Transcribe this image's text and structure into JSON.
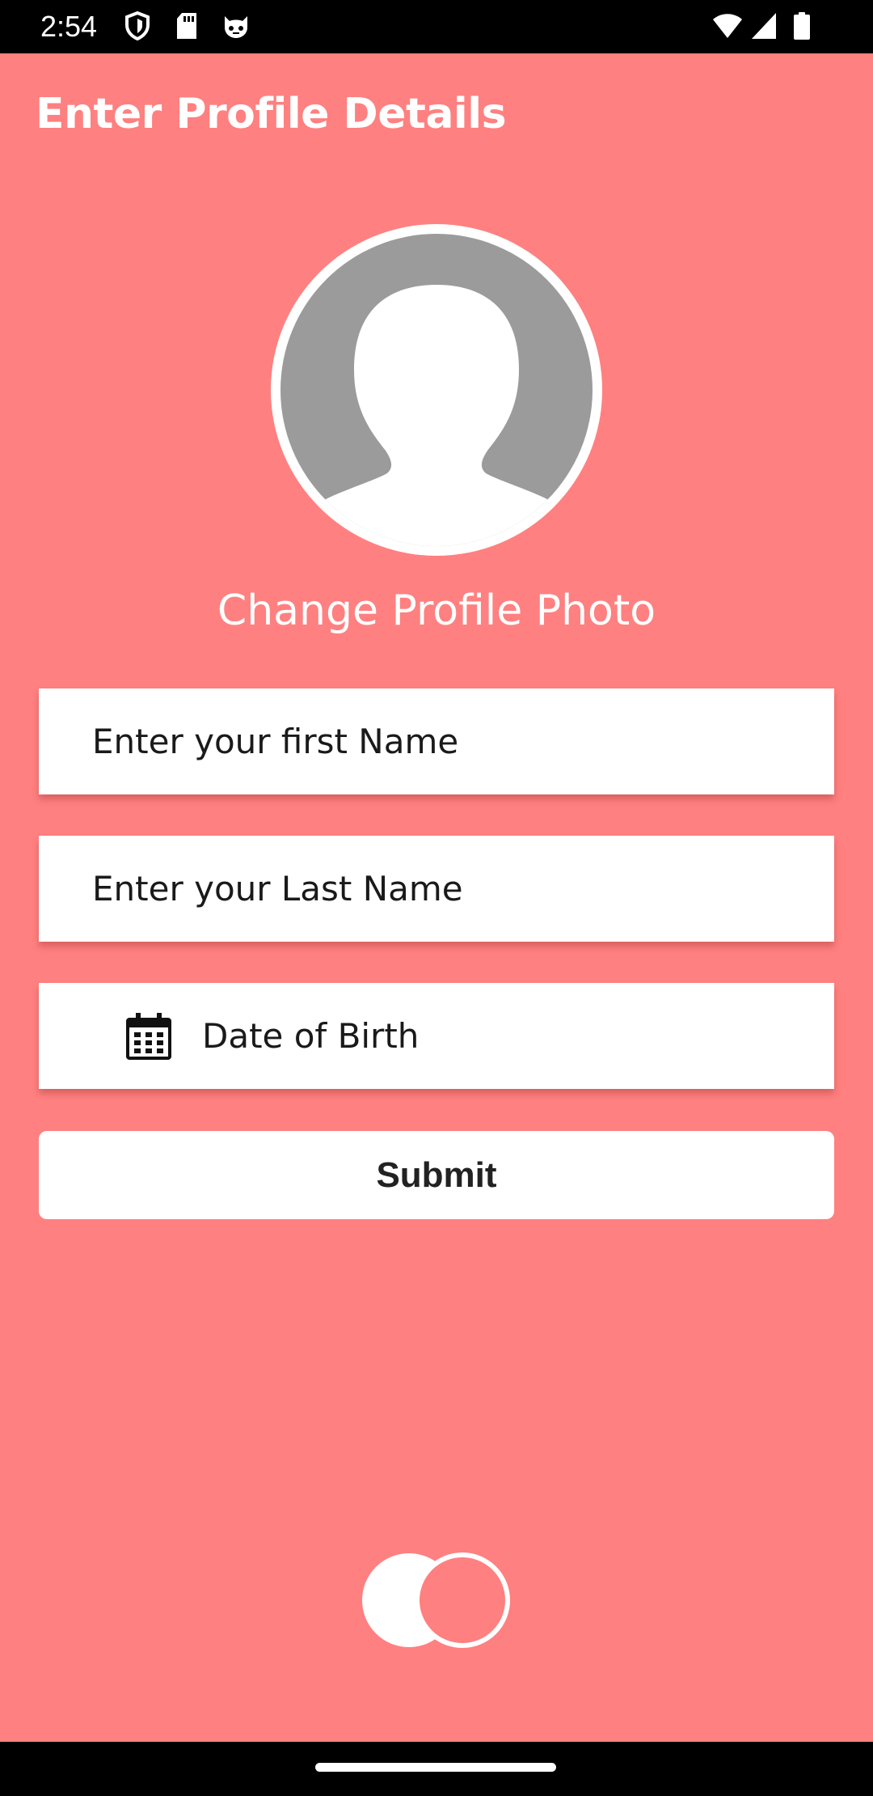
{
  "status_bar": {
    "time": "2:54",
    "left_icons": [
      "shield-icon",
      "sd-card-icon",
      "cat-face-icon"
    ],
    "right_icons": [
      "wifi-icon",
      "signal-icon",
      "battery-icon"
    ]
  },
  "header": {
    "title": "Enter Profile Details"
  },
  "profile": {
    "avatar_icon": "default-avatar-icon",
    "change_photo_label": "Change Profile Photo"
  },
  "form": {
    "first_name_placeholder": "Enter your first Name",
    "last_name_placeholder": "Enter your Last Name",
    "dob_placeholder": "Date of Birth",
    "dob_icon": "calendar-icon",
    "submit_label": "Submit"
  },
  "loader": {
    "icon": "loading-indicator"
  },
  "colors": {
    "background": "#ff8080",
    "field_background": "#ffffff",
    "avatar_gray": "#9b9b9b"
  }
}
